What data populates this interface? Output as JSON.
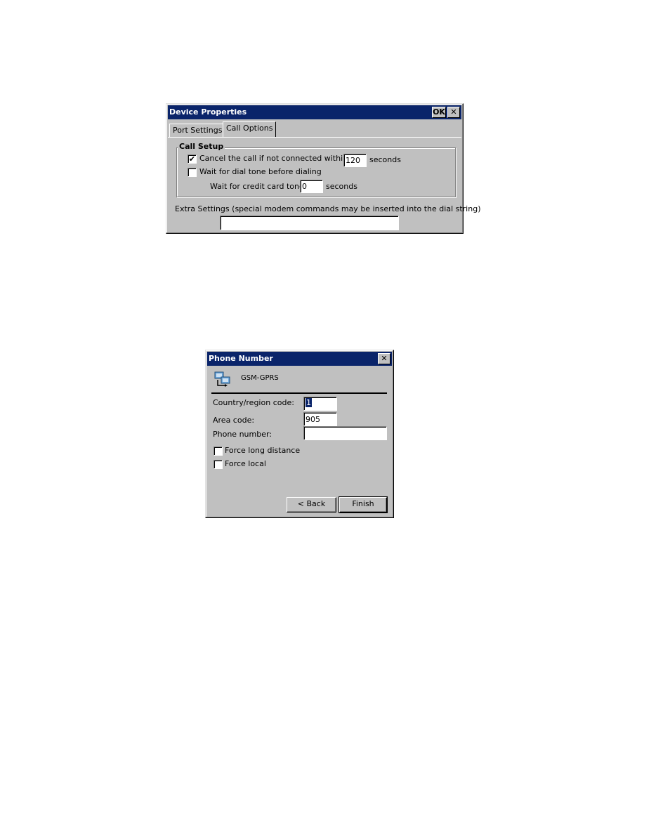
{
  "device_properties": {
    "title": "Device Properties",
    "ok_label": "OK",
    "close_label": "✕",
    "tabs": [
      {
        "label": "Port Settings",
        "active": false
      },
      {
        "label": "Call Options",
        "active": true
      }
    ],
    "call_setup": {
      "legend": "Call Setup",
      "cancel_call_label": "Cancel the call if not connected within",
      "cancel_call_checked": true,
      "cancel_call_value": "120",
      "seconds_label_1": "seconds",
      "wait_dial_tone_label": "Wait for dial tone before dialing",
      "wait_dial_tone_checked": false,
      "credit_card_label": "Wait for credit card tone",
      "credit_card_value": "0",
      "seconds_label_2": "seconds"
    },
    "extra_settings_label": "Extra Settings (special modem commands may be inserted into the dial string)",
    "extra_settings_value": ""
  },
  "phone_number": {
    "title": "Phone Number",
    "close_label": "✕",
    "connection_name": "GSM-GPRS",
    "country_label": "Country/region code:",
    "country_value": "1",
    "area_label": "Area code:",
    "area_value": "905",
    "phone_label": "Phone number:",
    "phone_value": "",
    "force_long_label": "Force long distance",
    "force_local_label": "Force local",
    "back_label": "< Back",
    "finish_label": "Finish"
  },
  "icons": {
    "checkmark": "✔",
    "connection": "connection-icon"
  }
}
